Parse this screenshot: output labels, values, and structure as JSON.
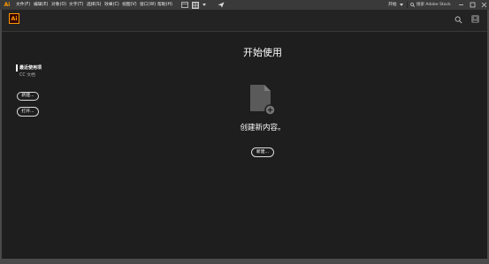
{
  "app": {
    "logo_text": "Ai"
  },
  "colors": {
    "accent": "#FF9A00",
    "logo_background": "#330000",
    "background": "#1E1E1E"
  },
  "menubar": {
    "items": [
      "文件(F)",
      "编辑(E)",
      "对象(O)",
      "文字(T)",
      "选择(S)",
      "效果(C)",
      "视图(V)",
      "窗口(W)",
      "帮助(H)"
    ],
    "tool_icons": [
      "bridge-icon",
      "arrange-documents-icon",
      "chevron-down-icon",
      "gpu-performance-icon"
    ],
    "workspace_label": "开始",
    "workspace_icon": "chevron-down-icon",
    "search_icon": "search-icon",
    "search_placeholder": "搜索 Adobe Stock",
    "window_controls": [
      "minimize-icon",
      "maximize-icon",
      "close-icon"
    ]
  },
  "header": {
    "search_icon": "search-icon",
    "account_icon": "user-icon"
  },
  "sidebar": {
    "items": [
      {
        "label": "最近使用项",
        "active": true
      },
      {
        "label": "CC 文档",
        "active": false
      }
    ],
    "new_button": "新建...",
    "open_button": "打开..."
  },
  "main": {
    "title": "开始使用",
    "empty_state_icon": "new-document-icon",
    "empty_state_message": "创建新内容。",
    "new_button": "新建..."
  }
}
